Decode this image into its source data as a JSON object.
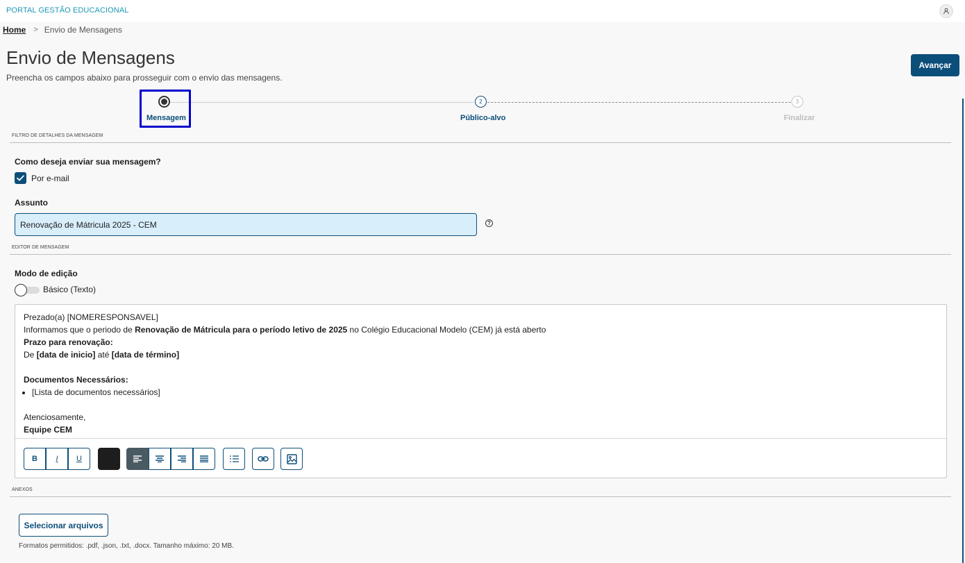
{
  "header": {
    "brand": "PORTAL GESTÃO EDUCACIONAL",
    "user_icon": "user-icon"
  },
  "breadcrumb": {
    "home": "Home",
    "separator": ">",
    "current": "Envio de Mensagens"
  },
  "page": {
    "title": "Envio de Mensagens",
    "subtitle": "Preencha os campos abaixo para prosseguir com o envio das mensagens.",
    "next_button": "Avançar"
  },
  "stepper": {
    "steps": [
      {
        "number": "1",
        "label": "Mensagem",
        "state": "active"
      },
      {
        "number": "2",
        "label": "Público-alvo",
        "state": "next"
      },
      {
        "number": "3",
        "label": "Finalizar",
        "state": "disabled"
      }
    ]
  },
  "sections": {
    "filter": "FILTRO DE DETALHES DA MENSAGEM",
    "editor": "EDITOR DE MENSAGEM",
    "attachments": "ANEXOS"
  },
  "form": {
    "send_method_label": "Como deseja enviar sua mensagem?",
    "email_option": "Por e-mail",
    "email_checked": true,
    "subject_label": "Assunto",
    "subject_value": "Renovação de Mátricula 2025 - CEM",
    "help_symbol": "?",
    "edit_mode_label": "Modo de edição",
    "edit_mode_option": "Básico (Texto)",
    "edit_mode_on": false
  },
  "message": {
    "greeting": "Prezado(a) [NOMERESPONSAVEL]",
    "intro_pre": "Informamos que o periodo de ",
    "intro_bold": "Renovação de Mátricula para o período letivo de 2025",
    "intro_post": " no Colégio Educacional Modelo (CEM) já está aberto",
    "deadline_title": "Prazo para renovação:",
    "deadline_de": "De ",
    "deadline_start": "[data de inicio]",
    "deadline_ate": " até ",
    "deadline_end": "[data de término]",
    "docs_title": "Documentos Necessários:",
    "docs_item": "[Lista de documentos necessários]",
    "closing": "Atenciosamente,",
    "signature": "Equipe CEM"
  },
  "toolbar": {
    "bold": "B",
    "italic": "I",
    "underline": "U",
    "text_color": "#1d1d1d"
  },
  "attachments": {
    "select_button": "Selecionar arquivos",
    "hint": "Formatos permitidos: .pdf, .json, .txt, .docx. Tamanho máximo: 20 MB."
  },
  "colors": {
    "primary": "#0c4e7a",
    "brand": "#1d98b5",
    "focus": "#0000cd"
  }
}
